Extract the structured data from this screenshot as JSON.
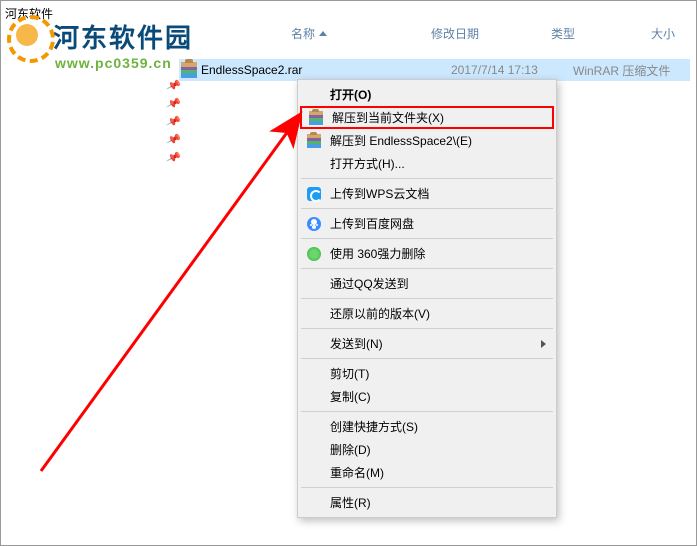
{
  "window": {
    "title": "河东软件"
  },
  "logo": {
    "text": "河东软件园",
    "url": "www.pc0359.cn"
  },
  "columns": {
    "name": "名称",
    "date": "修改日期",
    "type": "类型",
    "size": "大小"
  },
  "file": {
    "name": "EndlessSpace2.rar",
    "date": "2017/7/14 17:13",
    "type": "WinRAR 压缩文件"
  },
  "menu": {
    "open": "打开(O)",
    "extract_here": "解压到当前文件夹(X)",
    "extract_to": "解压到 EndlessSpace2\\(E)",
    "open_with": "打开方式(H)...",
    "wps_cloud": "上传到WPS云文档",
    "baidu": "上传到百度网盘",
    "del360": "使用 360强力删除",
    "qq_send": "通过QQ发送到",
    "restore": "还原以前的版本(V)",
    "send_to": "发送到(N)",
    "cut": "剪切(T)",
    "copy": "复制(C)",
    "shortcut": "创建快捷方式(S)",
    "delete": "删除(D)",
    "rename": "重命名(M)",
    "properties": "属性(R)"
  }
}
